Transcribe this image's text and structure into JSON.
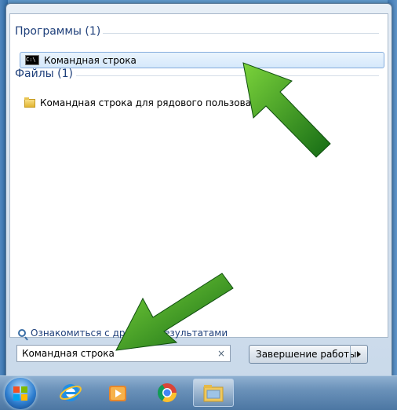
{
  "startmenu": {
    "groups": [
      {
        "header": "Программы (1)",
        "items": [
          "Командная строка"
        ]
      },
      {
        "header": "Файлы (1)",
        "items": [
          "Командная строка для рядового пользователя"
        ]
      }
    ],
    "more_results": "Ознакомиться с другими результатами",
    "search": {
      "value": "Командная строка",
      "clear": "×"
    },
    "shutdown": {
      "label": "Завершение работы"
    }
  },
  "taskbar": {
    "apps": [
      "start-orb",
      "internet-explorer-icon",
      "media-player-icon",
      "chrome-icon",
      "file-explorer-icon"
    ]
  },
  "overlay": {
    "arrow_color": "#1f8c1f"
  }
}
